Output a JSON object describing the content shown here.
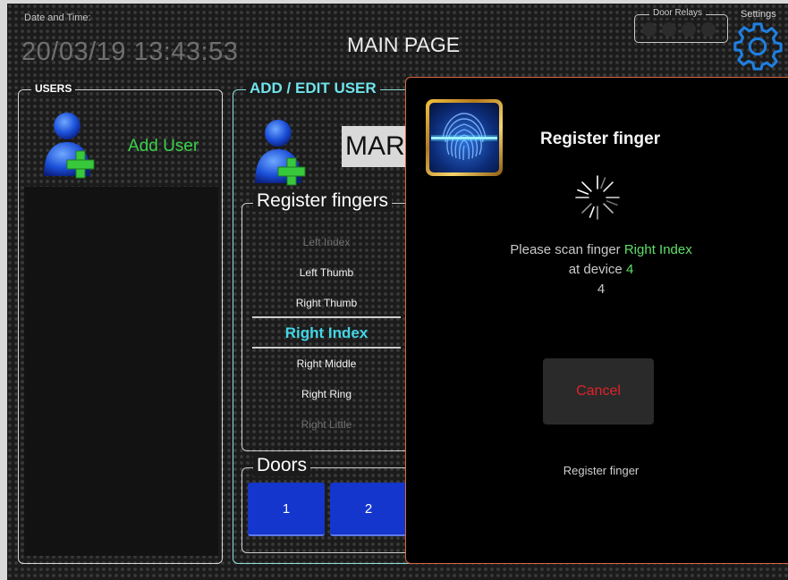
{
  "header": {
    "datetime_label": "Date and Time:",
    "datetime_value": "20/03/19 13:43:53",
    "title": "MAIN PAGE",
    "door_relays_label": "Door Relays",
    "settings_label": "Settings",
    "settings_icon": "gear-icon"
  },
  "users_panel": {
    "title": "USERS",
    "add_user_label": "Add User",
    "add_user_icon": "add-user-icon"
  },
  "edit_panel": {
    "title": "ADD / EDIT USER",
    "name_value": "MAR",
    "fingers_title": "Register fingers",
    "fingers": [
      "Left Index",
      "Left Thumb",
      "Right Thumb",
      "Right Index",
      "Right Middle",
      "Right Ring",
      "Right  Little"
    ],
    "selected_finger": "Right Index",
    "doors_title": "Doors",
    "doors": [
      "1",
      "2"
    ]
  },
  "modal": {
    "title": "Register finger",
    "icon": "fingerprint-scan-icon",
    "prompt_prefix": "Please scan finger",
    "prompt_finger": "Right Index",
    "device_prefix": "at device",
    "device_number": "4",
    "count": "4",
    "cancel_label": "Cancel",
    "footer": "Register finger"
  },
  "colors": {
    "accent_green": "#39d04a",
    "accent_cyan": "#43d6e6",
    "door_blue": "#1436cc",
    "cancel_red": "#e0232b",
    "modal_border": "#d9673c"
  }
}
